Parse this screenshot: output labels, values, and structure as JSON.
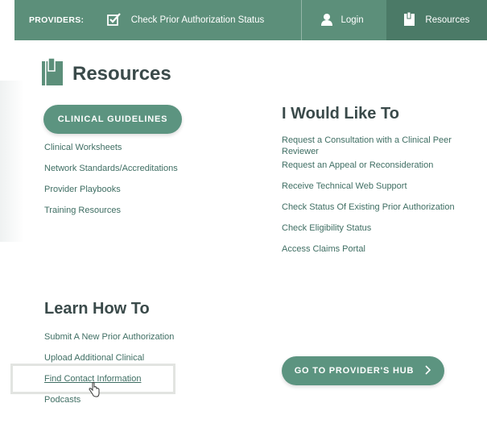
{
  "topbar": {
    "providers_label": "PROVIDERS:",
    "check_status": "Check Prior Authorization Status",
    "login": "Login",
    "resources": "Resources"
  },
  "panel": {
    "title": "Resources",
    "guidelines_button": "CLINICAL GUIDELINES",
    "left_links": [
      "Clinical Worksheets",
      "Network Standards/Accreditations",
      "Provider Playbooks",
      "Training Resources"
    ],
    "would_like_heading": "I Would Like To",
    "right_links": [
      "Request a Consultation with a Clinical Peer Reviewer",
      "Request an Appeal or Reconsideration",
      "Receive Technical Web Support",
      "Check Status Of Existing Prior Authorization",
      "Check Eligibility Status",
      "Access Claims Portal"
    ],
    "learn_heading": "Learn How To",
    "learn_links": [
      "Submit A New Prior Authorization",
      "Upload Additional Clinical",
      "Find Contact Information",
      "Podcasts"
    ],
    "hub_button": "GO TO PROVIDER'S HUB"
  },
  "colors": {
    "nav_bg": "#5c8f7a",
    "nav_active": "#4b7a67",
    "accent": "#5c9480",
    "link": "#3f6e63"
  },
  "icons": {
    "check": "checkbox-check-icon",
    "login": "person-icon",
    "resources": "book-icon",
    "hub_chevron": "chevron-right-icon",
    "cursor": "hand-pointer-icon"
  }
}
